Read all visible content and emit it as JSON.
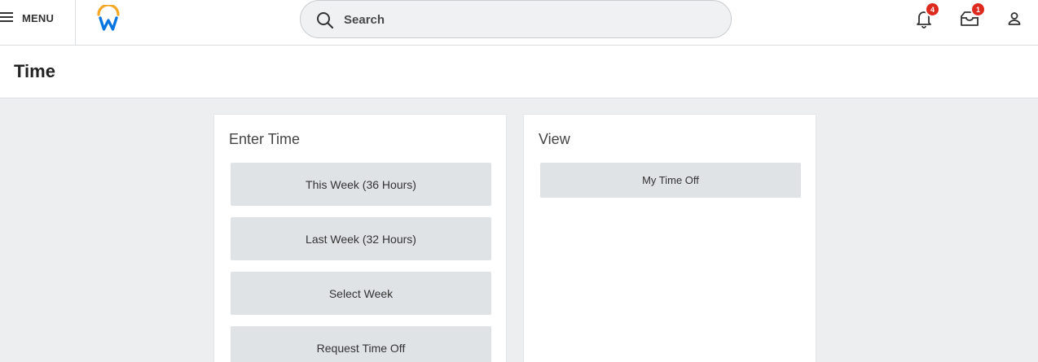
{
  "header": {
    "menu_label": "MENU",
    "search_placeholder": "Search",
    "notifications_count": "4",
    "inbox_count": "1"
  },
  "page": {
    "title": "Time"
  },
  "enter_time": {
    "title": "Enter Time",
    "buttons": [
      {
        "label": "This Week (36 Hours)"
      },
      {
        "label": "Last Week (32 Hours)"
      },
      {
        "label": "Select Week"
      },
      {
        "label": "Request Time Off"
      }
    ]
  },
  "view": {
    "title": "View",
    "buttons": [
      {
        "label": "My Time Off"
      }
    ]
  },
  "colors": {
    "logo_blue": "#0875e1",
    "logo_orange": "#f5a623",
    "badge_red": "#de2a1e",
    "page_bg": "#eceeef",
    "button_bg": "#dfe3e6"
  },
  "icons": {
    "menu": "hamburger-icon",
    "logo": "workday-logo",
    "search": "search-icon",
    "notifications": "bell-icon",
    "inbox": "inbox-icon",
    "profile": "user-icon"
  }
}
